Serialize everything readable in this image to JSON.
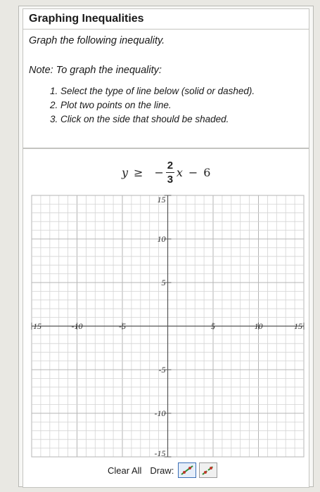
{
  "header": {
    "title": "Graphing Inequalities"
  },
  "instructions": {
    "prompt": "Graph the following inequality.",
    "note": "Note: To graph the inequality:",
    "steps": [
      "Select the type of line below (solid or dashed).",
      "Plot two points on the line.",
      "Click on the side that should be shaded."
    ]
  },
  "equation": {
    "lhs": "y",
    "relation": "≥",
    "sign": "−",
    "numerator": "2",
    "denominator": "3",
    "variable": "x",
    "constant_sign": "−",
    "constant": "6"
  },
  "graph": {
    "x_range": [
      -15,
      15
    ],
    "y_range": [
      -15,
      15
    ],
    "grid_step": 1,
    "x_tick_labels": [
      "15",
      "-10",
      "-5",
      "5",
      "10",
      "15"
    ],
    "x_tick_values": [
      -15,
      -10,
      -5,
      5,
      10,
      15
    ],
    "y_tick_labels": [
      "15",
      "10",
      "5",
      "-5",
      "-10",
      "-15"
    ],
    "y_tick_values": [
      15,
      10,
      5,
      -5,
      -10,
      -15
    ]
  },
  "toolbar": {
    "clear_all": "Clear All",
    "draw_label": "Draw:",
    "tools": [
      {
        "name": "solid-line-tool-icon",
        "selected": true
      },
      {
        "name": "dashed-line-tool-icon",
        "selected": false
      }
    ],
    "line_color": "#2e8b2e"
  }
}
